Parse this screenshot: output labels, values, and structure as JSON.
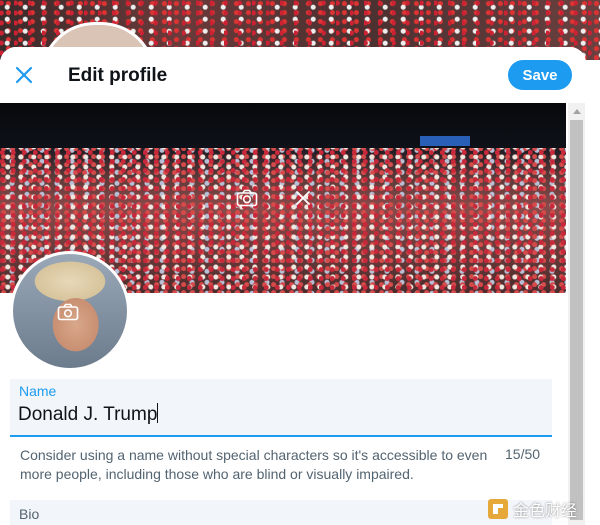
{
  "header": {
    "title": "Edit profile",
    "save_label": "Save",
    "close_icon": "close-icon"
  },
  "banner": {
    "camera_icon": "camera-icon",
    "remove_icon": "close-icon"
  },
  "avatar": {
    "camera_icon": "camera-icon"
  },
  "name_field": {
    "label": "Name",
    "value": "Donald J. Trump",
    "hint": "Consider using a name without special characters so it's accessible to even more people, including those who are blind or visually impaired.",
    "counter": "15/50"
  },
  "bio_field": {
    "label": "Bio"
  },
  "watermark": {
    "text": "金色财经"
  },
  "colors": {
    "accent": "#1d9bf0",
    "text_primary": "#0f1419",
    "text_secondary": "#536471",
    "field_bg": "#f2f6fa"
  }
}
